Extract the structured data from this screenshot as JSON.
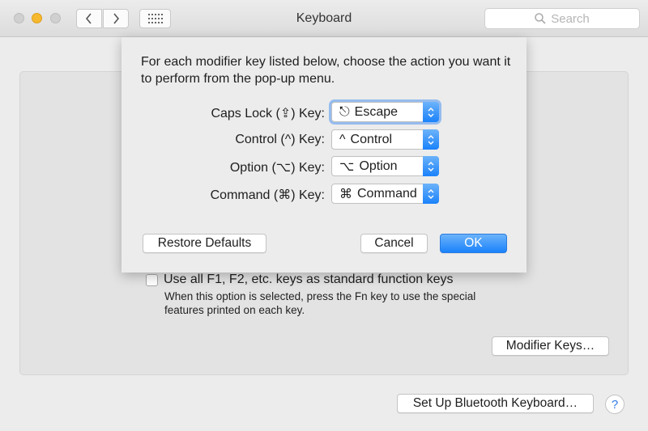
{
  "window": {
    "title": "Keyboard"
  },
  "search": {
    "placeholder": "Search"
  },
  "sheet": {
    "intro": "For each modifier key listed below, choose the action you want it to perform from the pop-up menu.",
    "rows": [
      {
        "label": "Caps Lock (⇪) Key:",
        "value": "Escape",
        "glyph": "⎋"
      },
      {
        "label": "Control (^) Key:",
        "value": "Control",
        "glyph": "^"
      },
      {
        "label": "Option (⌥) Key:",
        "value": "Option",
        "glyph": "⌥"
      },
      {
        "label": "Command (⌘) Key:",
        "value": "Command",
        "glyph": "⌘"
      }
    ],
    "restore_label": "Restore Defaults",
    "cancel_label": "Cancel",
    "ok_label": "OK"
  },
  "main": {
    "fn_checkbox_label": "Use all F1, F2, etc. keys as standard function keys",
    "fn_checked": false,
    "fn_description": "When this option is selected, press the Fn key to use the special features printed on each key.",
    "modifier_keys_label": "Modifier Keys…",
    "bluetooth_label": "Set Up Bluetooth Keyboard…",
    "help_label": "?"
  },
  "colors": {
    "accent": "#1a82fb",
    "minimize": "#f5b82e"
  }
}
